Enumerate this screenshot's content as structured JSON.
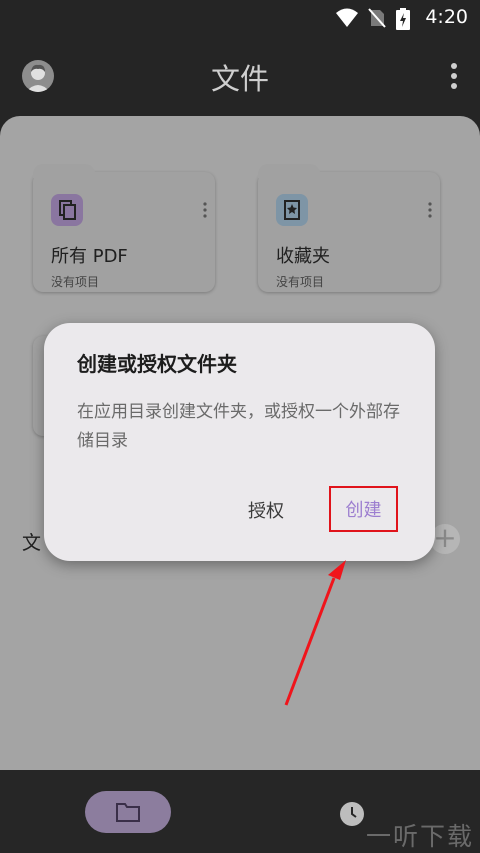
{
  "status_bar": {
    "time": "4:20"
  },
  "header": {
    "title": "文件"
  },
  "cards": [
    {
      "title": "所有 PDF",
      "subtitle": "没有项目",
      "icon": "pdf-document-icon",
      "icon_color": "#8a76a0"
    },
    {
      "title": "收藏夹",
      "subtitle": "没有项目",
      "icon": "bookmark-star-icon",
      "icon_color": "#7e95a6"
    }
  ],
  "section": {
    "label_visible": "文"
  },
  "dialog": {
    "title": "创建或授权文件夹",
    "body": "在应用目录创建文件夹，或授权一个外部存储目录",
    "authorize_label": "授权",
    "create_label": "创建",
    "accent_color": "#9d7fd0",
    "highlight_color": "#e0131b"
  },
  "watermark": "一听下载"
}
